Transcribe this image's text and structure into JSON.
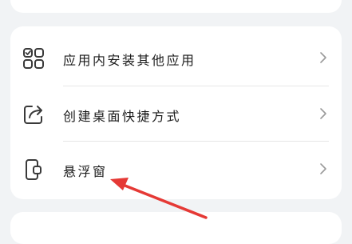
{
  "settings": {
    "items": [
      {
        "label": "应用内安装其他应用",
        "icon": "apps-grid-icon"
      },
      {
        "label": "创建桌面快捷方式",
        "icon": "share-shortcut-icon"
      },
      {
        "label": "悬浮窗",
        "icon": "floating-window-icon"
      }
    ]
  },
  "colors": {
    "background": "#f1f3f5",
    "card": "#ffffff",
    "text": "#1b1b1b",
    "icon": "#3a3a3a",
    "chevron": "#9a9a9a",
    "annotation_arrow": "#e53935"
  }
}
